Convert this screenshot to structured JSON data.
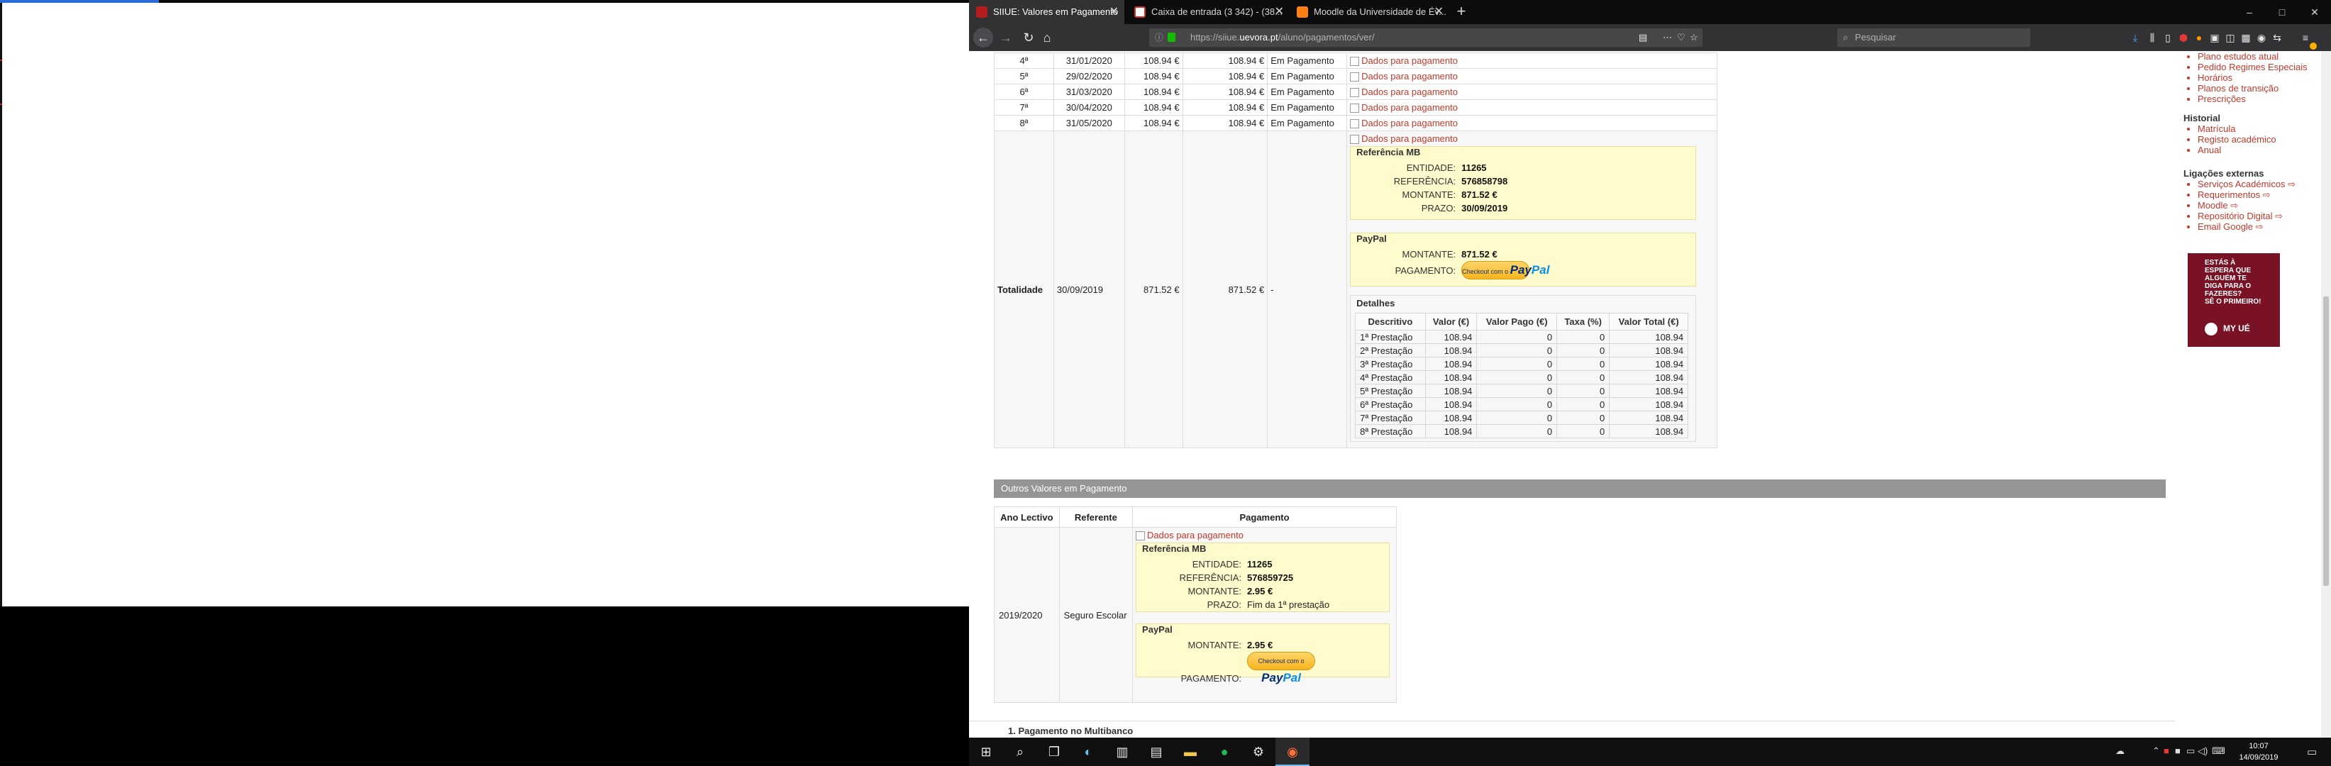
{
  "browser": {
    "tabs": [
      {
        "label": "SIIUE: Valores em Pagamento",
        "active": true
      },
      {
        "label": "Caixa de entrada (3 342) - (38..."
      },
      {
        "label": "Moodle da Universidade de Év..."
      }
    ],
    "new_tab": "+",
    "window": {
      "minimize": "–",
      "maximize": "□",
      "close": "✕"
    },
    "url": {
      "prefix": "https://siiue.",
      "host": "uevora.pt",
      "path": "/aluno/pagamentos/ver/"
    },
    "search_placeholder": "Pesquisar"
  },
  "payments": {
    "rows": [
      {
        "n": "4ª",
        "date": "31/01/2020",
        "v1": "108.94 €",
        "v2": "108.94 €",
        "status": "Em Pagamento",
        "link": "Dados para pagamento"
      },
      {
        "n": "5ª",
        "date": "29/02/2020",
        "v1": "108.94 €",
        "v2": "108.94 €",
        "status": "Em Pagamento",
        "link": "Dados para pagamento"
      },
      {
        "n": "6ª",
        "date": "31/03/2020",
        "v1": "108.94 €",
        "v2": "108.94 €",
        "status": "Em Pagamento",
        "link": "Dados para pagamento"
      },
      {
        "n": "7ª",
        "date": "30/04/2020",
        "v1": "108.94 €",
        "v2": "108.94 €",
        "status": "Em Pagamento",
        "link": "Dados para pagamento"
      },
      {
        "n": "8ª",
        "date": "31/05/2020",
        "v1": "108.94 €",
        "v2": "108.94 €",
        "status": "Em Pagamento",
        "link": "Dados para pagamento"
      }
    ],
    "total": {
      "label": "Totalidade",
      "date": "30/09/2019",
      "v1": "871.52 €",
      "v2": "871.52 €",
      "status": "-",
      "link": "Dados para pagamento",
      "mb": {
        "title": "Referência MB",
        "entidade_k": "ENTIDADE:",
        "entidade_v": "11265",
        "ref_k": "REFERÊNCIA:",
        "ref_v": "576858798",
        "montante_k": "MONTANTE:",
        "montante_v": "871.52 €",
        "prazo_k": "PRAZO:",
        "prazo_v": "30/09/2019"
      },
      "paypal": {
        "title": "PayPal",
        "montante_k": "MONTANTE:",
        "montante_v": "871.52 €",
        "pagamento_k": "PAGAMENTO:",
        "btn_small": "Checkout com o",
        "btn_pay": "Pay",
        "btn_pal": "Pal"
      },
      "details": {
        "title": "Detalhes",
        "headers": [
          "Descritivo",
          "Valor (€)",
          "Valor Pago (€)",
          "Taxa (%)",
          "Valor Total (€)"
        ],
        "rows": [
          [
            "1ª Prestação",
            "108.94",
            "0",
            "0",
            "108.94"
          ],
          [
            "2ª Prestação",
            "108.94",
            "0",
            "0",
            "108.94"
          ],
          [
            "3ª Prestação",
            "108.94",
            "0",
            "0",
            "108.94"
          ],
          [
            "4ª Prestação",
            "108.94",
            "0",
            "0",
            "108.94"
          ],
          [
            "5ª Prestação",
            "108.94",
            "0",
            "0",
            "108.94"
          ],
          [
            "6ª Prestação",
            "108.94",
            "0",
            "0",
            "108.94"
          ],
          [
            "7ª Prestação",
            "108.94",
            "0",
            "0",
            "108.94"
          ],
          [
            "8ª Prestação",
            "108.94",
            "0",
            "0",
            "108.94"
          ]
        ]
      }
    }
  },
  "others": {
    "heading": "Outros Valores em Pagamento",
    "headers": [
      "Ano Lectivo",
      "Referente",
      "Pagamento"
    ],
    "row": {
      "year": "2019/2020",
      "ref": "Seguro Escolar",
      "link": "Dados para pagamento",
      "mb": {
        "title": "Referência MB",
        "entidade_k": "ENTIDADE:",
        "entidade_v": "11265",
        "ref_k": "REFERÊNCIA:",
        "ref_v": "576859725",
        "montante_k": "MONTANTE:",
        "montante_v": "2.95 €",
        "prazo_k": "PRAZO:",
        "prazo_v": "Fim da 1ª prestação"
      },
      "paypal": {
        "title": "PayPal",
        "montante_k": "MONTANTE:",
        "montante_v": "2.95 €",
        "pagamento_k": "PAGAMENTO:",
        "btn_small": "Checkout com o",
        "btn_pay": "Pay",
        "btn_pal": "Pal"
      }
    },
    "multibanco": "1. Pagamento no Multibanco"
  },
  "sidebar": {
    "top_links": [
      "Plano estudos atual",
      "Pedido Regimes Especiais",
      "Horários",
      "Planos de transição",
      "Prescrições"
    ],
    "historial": {
      "title": "Historial",
      "links": [
        "Matrícula",
        "Registo académico",
        "Anual"
      ]
    },
    "externas": {
      "title": "Ligações externas",
      "links": [
        "Serviços Académicos ⇨",
        "Requerimentos ⇨",
        "Moodle ⇨",
        "Repositório Digital ⇨",
        "Email Google ⇨"
      ]
    },
    "ad": {
      "lines": [
        "ESTÁS À",
        "ESPERA QUE",
        "ALGUÉM TE",
        "DIGA PARA O",
        "FAZERES?",
        "SÊ O PRIMEIRO!"
      ],
      "brand": "MY UÉ"
    }
  },
  "taskbar": {
    "time": "10:07",
    "date": "14/09/2019"
  }
}
